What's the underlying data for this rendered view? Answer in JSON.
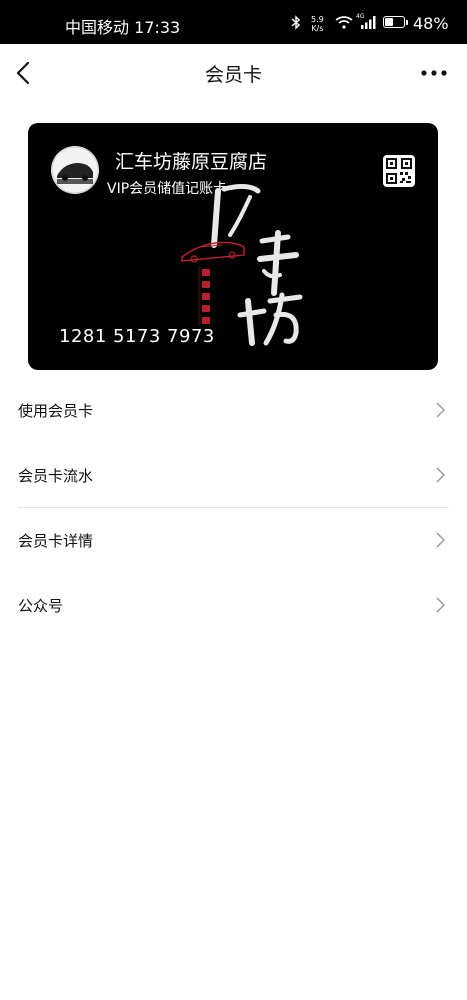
{
  "status_bar": {
    "carrier_time": "中国移动 17:33",
    "net_speed_value": "5.9",
    "net_speed_unit": "K/s",
    "network_type": "4G",
    "battery_percent": "48%",
    "battery_level": 0.48
  },
  "nav": {
    "title": "会员卡",
    "back_icon": "chevron-left-icon",
    "more_icon": "more-dots-icon"
  },
  "card": {
    "store_name": "汇车坊藤原豆腐店",
    "card_type": "VIP会员储值记账卡",
    "card_number": "1281 5173 7973",
    "background_color": "#000000",
    "logo": "store-logo",
    "qr_icon": "qr-code-icon",
    "artwork": {
      "title_chars": "汇车坊",
      "subtitle_chars": "藤原豆腐店"
    }
  },
  "menu": {
    "items": [
      {
        "label": "使用会员卡"
      },
      {
        "label": "会员卡流水"
      },
      {
        "label": "会员卡详情"
      },
      {
        "label": "公众号"
      }
    ]
  }
}
